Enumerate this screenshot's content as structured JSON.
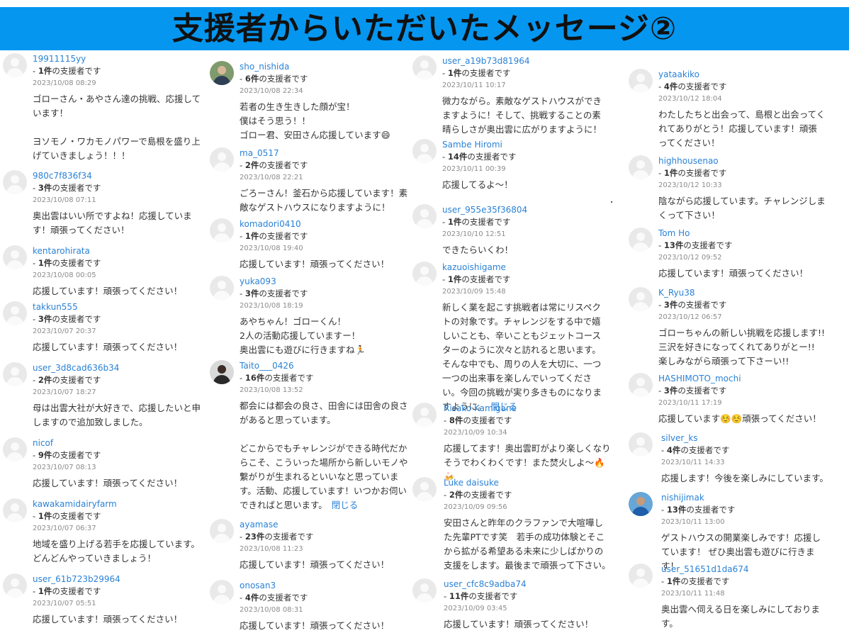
{
  "header": {
    "title": "支援者からいただいたメッセージ②"
  },
  "count_suffix": "の支援者です",
  "close_label": "閉じる",
  "columns": [
    {
      "messages": [
        {
          "name": "19911115yy",
          "count": "1件",
          "date": "2023/10/08 08:29",
          "text": "ゴローさん・あやさん達の挑戦、応援しています！\n\nヨソモノ・ワカモノパワーで島根を盛り上げていきましょう！！！"
        },
        {
          "name": "980c7f836f34",
          "count": "3件",
          "date": "2023/10/08 07:11",
          "text": "奥出雲はいい所ですよね！応援しています！頑張ってください！"
        },
        {
          "name": "kentarohirata",
          "count": "1件",
          "date": "2023/10/08 00:05",
          "text": "応援しています！頑張ってください！"
        },
        {
          "name": "takkun555",
          "count": "3件",
          "date": "2023/10/07 20:37",
          "text": "応援しています！頑張ってください！"
        },
        {
          "name": "user_3d8cad636b34",
          "count": "2件",
          "date": "2023/10/07 18:27",
          "text": "母は出雲大社が大好きで、応援したいと申しますので追加致しました。"
        },
        {
          "name": "nicof",
          "count": "9件",
          "date": "2023/10/07 08:13",
          "text": "応援しています！頑張ってください！"
        },
        {
          "name": "kawakamidairyfarm",
          "count": "1件",
          "date": "2023/10/07 06:37",
          "text": "地域を盛り上げる若手を応援しています。どんどんやっていきましょう！"
        },
        {
          "name": "user_61b723b29964",
          "count": "1件",
          "date": "2023/10/07 05:51",
          "text": "応援しています！頑張ってください！"
        }
      ]
    },
    {
      "messages": [
        {
          "name": "sho_nishida",
          "count": "6件",
          "date": "2023/10/08 22:34",
          "text": "若者の生き生きした顔が宝！\n僕はそう思う！！\nゴロー君、安田さん応援しています😄"
        },
        {
          "name": "ma_0517",
          "count": "2件",
          "date": "2023/10/08 22:21",
          "text": "ごろーさん！釜石から応援しています！素敵なゲストハウスになりますように！"
        },
        {
          "name": "komadori0410",
          "count": "1件",
          "date": "2023/10/08 19:40",
          "text": "応援しています！頑張ってください！"
        },
        {
          "name": "yuka093",
          "count": "3件",
          "date": "2023/10/08 18:19",
          "text": "あやちゃん！ゴローくん！\n2人の活動応援していますー！\n奥出雲にも遊びに行きますね🏃"
        },
        {
          "name": "Taito___0426",
          "count": "16件",
          "date": "2023/10/08 13:52",
          "text": "都会には都会の良さ、田舎には田舎の良さがあると思っています。\n\nどこからでもチャレンジができる時代だからこそ、こういった場所から新しいモノや繋がりが生まれるといいなと思っています。活動、応援しています！いつかお伺いできればと思います。"
        },
        {
          "name": "ayamase",
          "count": "23件",
          "date": "2023/10/08 11:23",
          "text": "応援しています！頑張ってください！"
        },
        {
          "name": "onosan3",
          "count": "4件",
          "date": "2023/10/08 08:31",
          "text": "応援しています！頑張ってください！"
        }
      ]
    },
    {
      "messages": [
        {
          "name": "user_a19b73d81964",
          "count": "1件",
          "date": "2023/10/11 10:17",
          "text": "微力ながら。素敵なゲストハウスができますように！そして、挑戦することの素晴らしさが奥出雲に広がりますように！"
        },
        {
          "name": "Sambe Hiromi",
          "count": "14件",
          "date": "2023/10/11 00:39",
          "text": "応援してるよ〜！"
        },
        {
          "name": "user_955e35f36804",
          "count": "1件",
          "date": "2023/10/10 12:51",
          "text": "できたらいくわ！"
        },
        {
          "name": "kazuoishigame",
          "count": "1件",
          "date": "2023/10/09 15:48",
          "text": "新しく業を起こす挑戦者は常にリスペクトの対象です。チャレンジをする中で嬉しいことも、辛いこともジェットコースターのように次々と訪れると思います。そんな中でも、周りの人を大切に、一つ一つの出来事を楽しんでいってください。今回の挑戦が実り多きものになりますように。"
        },
        {
          "name": "Risako Kamigane",
          "count": "8件",
          "date": "2023/10/09 10:34",
          "text": "応援してます！奥出雲町がより楽しくなりそうでわくわくです！また焚火しよ〜🔥🍻"
        },
        {
          "name": "Luke daisuke",
          "count": "2件",
          "date": "2023/10/09 09:56",
          "text": "安田さんと昨年のクラファンで大喧嘩した先輩PTです笑　若手の成功体験とそこから拡がる希望ある未来に少しばかりの支援をします。最後まで頑張って下さい。"
        },
        {
          "name": "user_cfc8c9adba74",
          "count": "11件",
          "date": "2023/10/09 03:45",
          "text": "応援しています！頑張ってください！"
        }
      ]
    },
    {
      "messages": [
        {
          "name": "yataakiko",
          "count": "4件",
          "date": "2023/10/12 18:04",
          "text": "わたしたちと出会って、島根と出会ってくれてありがとう！応援しています！頑張ってください！"
        },
        {
          "name": "highhousenao",
          "count": "1件",
          "date": "2023/10/12 10:33",
          "text": "陰ながら応援しています。チャレンジしまくって下さい！"
        },
        {
          "name": "Tom Ho",
          "count": "13件",
          "date": "2023/10/12 09:52",
          "text": "応援しています！頑張ってください！"
        },
        {
          "name": "K_Ryu38",
          "count": "3件",
          "date": "2023/10/12 06:57",
          "text": "ゴローちゃんの新しい挑戦を応援します!!\n三沢を好きになってくれてありがとー!!\n楽しみながら頑張って下さーい!!"
        },
        {
          "name": "HASHIMOTO_mochi",
          "count": "3件",
          "date": "2023/10/11 17:19",
          "text": "応援しています☺️☺️頑張ってください！"
        },
        {
          "name": "silver_ks",
          "count": "4件",
          "date": "2023/10/11 14:33",
          "text": "応援します！今後を楽しみにしています。"
        },
        {
          "name": "nishijimak",
          "count": "13件",
          "date": "2023/10/11 13:00",
          "text": "ゲストハウスの開業楽しみです！応援しています！ ぜひ奥出雲も遊びに行きます！"
        },
        {
          "name": "user_51651d1da674",
          "count": "1件",
          "date": "2023/10/11 11:48",
          "text": "奥出雲へ伺える日を楽しみにしております。"
        }
      ]
    }
  ]
}
